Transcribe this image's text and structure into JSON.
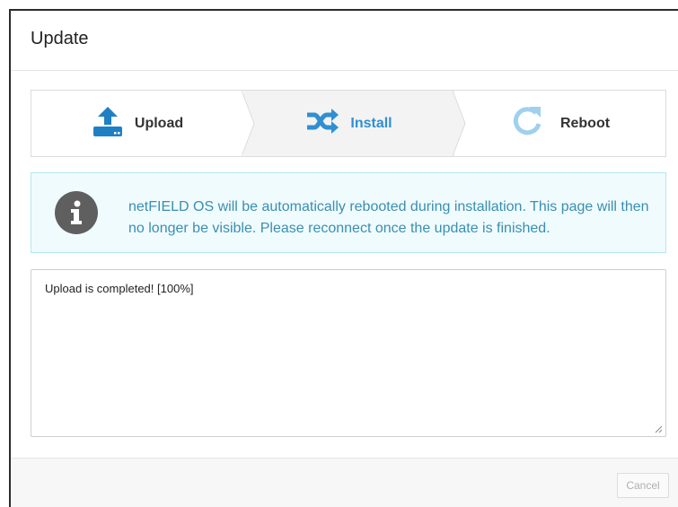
{
  "dialog": {
    "title": "Update"
  },
  "steps": [
    {
      "label": "Upload",
      "icon": "upload-icon",
      "active": false
    },
    {
      "label": "Install",
      "icon": "shuffle-icon",
      "active": true
    },
    {
      "label": "Reboot",
      "icon": "reboot-icon",
      "active": false
    }
  ],
  "alert": {
    "icon": "info-icon",
    "text": "netFIELD OS will be automatically rebooted during installation. This page will then no longer be visible. Please reconnect once the update is finished."
  },
  "log": {
    "text": "Upload is completed! [100%]"
  },
  "footer": {
    "cancel_label": "Cancel"
  },
  "colors": {
    "accent": "#2f8fd3",
    "upload_icon": "#1f7fc4",
    "reboot_icon": "#9fd0ee",
    "alert_bg": "#f0fbfd",
    "alert_border": "#b6e6f0",
    "alert_text": "#3a8fb0"
  }
}
